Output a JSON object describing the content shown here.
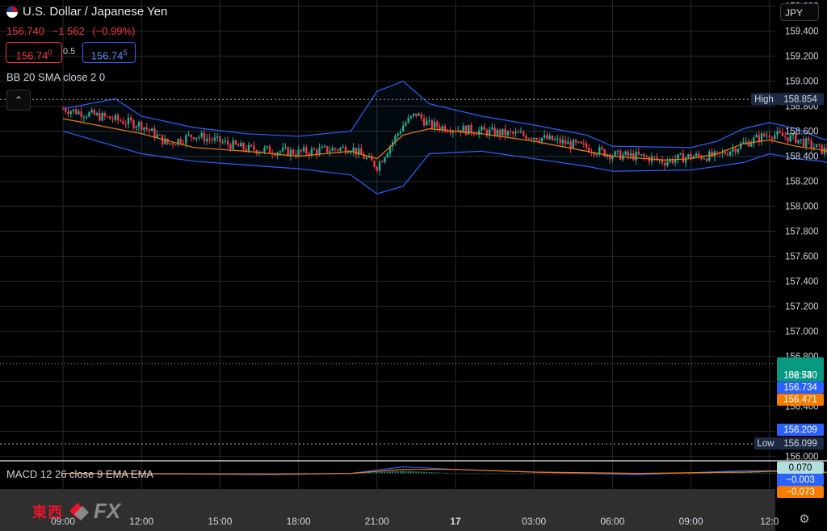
{
  "header": {
    "title": "U.S. Dollar / Japanese Yen",
    "last": "156.740",
    "change": "−1.562",
    "change_pct": "(−0.99%)",
    "bid_main": "156.74",
    "bid_sup": "0",
    "spread": "0.5",
    "ask_main": "156.74",
    "ask_sup": "5",
    "indicator": "BB 20 SMA close 2 0",
    "collapse_icon": "chevron-up-icon",
    "currency": "JPY"
  },
  "macd": {
    "label": "MACD 12 26 close 9 EMA EMA",
    "histogram_value": "0.070",
    "macd_value": "−0.003",
    "signal_value": "−0.073"
  },
  "badges": {
    "high_label": "High",
    "high_value": "158.854",
    "last_value": "156.740",
    "countdown": "02:53",
    "upper_band_value": "156.734",
    "basis_value": "156.471",
    "lower_band_value": "156.209",
    "low_label": "Low",
    "low_value": "156.099"
  },
  "watermark": {
    "kanji": "東西",
    "fx": "FX"
  },
  "colors": {
    "up": "#22ab94",
    "down": "#f23645",
    "band": "#2962ff",
    "basis": "#f57c00",
    "grid": "#2a2a2a",
    "macd_line": "#2962ff",
    "signal_line": "#f57c00"
  },
  "chart_data": {
    "type": "line",
    "y_ticks": [
      "159.600",
      "159.400",
      "159.200",
      "159.000",
      "158.800",
      "158.600",
      "158.400",
      "158.200",
      "158.000",
      "157.800",
      "157.600",
      "157.400",
      "157.200",
      "157.000",
      "156.800",
      "156.600",
      "156.400",
      "156.200",
      "156.000"
    ],
    "x_ticks": [
      "09:00",
      "12:00",
      "15:00",
      "18:00",
      "21:00",
      "17",
      "03:00",
      "06:00",
      "09:00",
      "12:0"
    ],
    "ylim": [
      155.97,
      159.65
    ],
    "series": [
      {
        "name": "BB 20 SMA close 2 0",
        "role": "close",
        "points": [
          [
            0,
            158.78
          ],
          [
            3,
            158.65
          ],
          [
            4,
            158.5
          ],
          [
            5,
            158.57
          ],
          [
            7,
            158.46
          ],
          [
            9,
            158.43
          ],
          [
            11,
            158.47
          ],
          [
            12,
            158.32
          ],
          [
            13,
            158.65
          ],
          [
            13.5,
            158.74
          ],
          [
            14,
            158.65
          ],
          [
            15,
            158.62
          ],
          [
            16,
            158.6
          ],
          [
            18,
            158.56
          ],
          [
            20,
            158.47
          ],
          [
            21,
            158.41
          ],
          [
            22,
            158.4
          ],
          [
            23,
            158.36
          ],
          [
            24,
            158.4
          ],
          [
            25,
            158.4
          ],
          [
            26,
            158.5
          ],
          [
            27,
            158.58
          ],
          [
            28,
            158.54
          ],
          [
            29,
            158.45
          ],
          [
            30,
            158.42
          ],
          [
            31,
            158.4
          ],
          [
            31.5,
            158.3
          ],
          [
            32,
            158.18
          ],
          [
            32.5,
            158.0
          ],
          [
            33,
            157.86
          ],
          [
            33.5,
            157.72
          ],
          [
            34,
            157.5
          ],
          [
            34.5,
            157.12
          ],
          [
            35,
            156.9
          ],
          [
            35.5,
            156.7
          ],
          [
            36,
            156.48
          ],
          [
            36.5,
            156.38
          ],
          [
            37,
            156.4
          ],
          [
            37.5,
            156.48
          ],
          [
            38,
            156.64
          ],
          [
            38.3,
            156.74
          ]
        ]
      },
      {
        "name": "upper band",
        "points": [
          [
            0,
            158.78
          ],
          [
            2,
            158.86
          ],
          [
            3,
            158.72
          ],
          [
            5,
            158.63
          ],
          [
            7,
            158.58
          ],
          [
            9,
            158.56
          ],
          [
            11,
            158.6
          ],
          [
            12,
            158.92
          ],
          [
            13,
            159.0
          ],
          [
            14,
            158.82
          ],
          [
            16,
            158.72
          ],
          [
            18,
            158.65
          ],
          [
            20,
            158.57
          ],
          [
            21,
            158.48
          ],
          [
            24,
            158.47
          ],
          [
            25,
            158.52
          ],
          [
            26,
            158.62
          ],
          [
            27,
            158.67
          ],
          [
            28,
            158.62
          ],
          [
            29,
            158.54
          ],
          [
            30,
            158.5
          ],
          [
            31,
            158.44
          ],
          [
            32,
            158.42
          ],
          [
            33,
            158.2
          ],
          [
            34,
            158.16
          ],
          [
            34.5,
            158.28
          ],
          [
            35,
            158.06
          ],
          [
            35.5,
            157.6
          ],
          [
            36,
            157.1
          ],
          [
            36.5,
            156.92
          ],
          [
            37,
            156.72
          ],
          [
            37.5,
            156.72
          ],
          [
            38,
            156.74
          ],
          [
            38.3,
            156.75
          ]
        ]
      },
      {
        "name": "basis",
        "points": [
          [
            0,
            158.7
          ],
          [
            3,
            158.58
          ],
          [
            5,
            158.47
          ],
          [
            7,
            158.44
          ],
          [
            9,
            158.4
          ],
          [
            11,
            158.44
          ],
          [
            12,
            158.38
          ],
          [
            13,
            158.57
          ],
          [
            14,
            158.62
          ],
          [
            16,
            158.58
          ],
          [
            18,
            158.52
          ],
          [
            20,
            158.44
          ],
          [
            21,
            158.4
          ],
          [
            23,
            158.37
          ],
          [
            24,
            158.38
          ],
          [
            25,
            158.42
          ],
          [
            26,
            158.5
          ],
          [
            27,
            158.53
          ],
          [
            28,
            158.48
          ],
          [
            29,
            158.45
          ],
          [
            30,
            158.4
          ],
          [
            31,
            158.3
          ],
          [
            32,
            158.1
          ],
          [
            33,
            157.85
          ],
          [
            34,
            157.48
          ],
          [
            35,
            157.08
          ],
          [
            35.5,
            156.76
          ],
          [
            36,
            156.55
          ],
          [
            36.5,
            156.4
          ],
          [
            37,
            156.34
          ],
          [
            37.5,
            156.38
          ],
          [
            38,
            156.42
          ],
          [
            38.3,
            156.47
          ]
        ]
      },
      {
        "name": "lower band",
        "points": [
          [
            0,
            158.6
          ],
          [
            3,
            158.42
          ],
          [
            5,
            158.36
          ],
          [
            7,
            158.33
          ],
          [
            9,
            158.3
          ],
          [
            11,
            158.25
          ],
          [
            12,
            158.1
          ],
          [
            13,
            158.16
          ],
          [
            14,
            158.42
          ],
          [
            16,
            158.44
          ],
          [
            18,
            158.38
          ],
          [
            20,
            158.32
          ],
          [
            21,
            158.28
          ],
          [
            24,
            158.29
          ],
          [
            25,
            158.32
          ],
          [
            26,
            158.35
          ],
          [
            27,
            158.42
          ],
          [
            28,
            158.38
          ],
          [
            29,
            158.36
          ],
          [
            30,
            158.3
          ],
          [
            31,
            158.18
          ],
          [
            32,
            157.8
          ],
          [
            33,
            157.48
          ],
          [
            34,
            157.02
          ],
          [
            35,
            156.6
          ],
          [
            35.5,
            156.28
          ],
          [
            36,
            156.08
          ],
          [
            36.5,
            156.06
          ],
          [
            37,
            156.14
          ],
          [
            37.5,
            156.2
          ],
          [
            38,
            156.22
          ],
          [
            38.3,
            156.21
          ]
        ]
      }
    ],
    "macd": {
      "ylim": [
        -0.12,
        0.09
      ],
      "macd_line": [
        [
          0,
          0.0
        ],
        [
          8,
          -0.01
        ],
        [
          11,
          0.0
        ],
        [
          13,
          0.05
        ],
        [
          15,
          0.03
        ],
        [
          18,
          0.01
        ],
        [
          22,
          -0.01
        ],
        [
          26,
          0.02
        ],
        [
          28,
          0.02
        ],
        [
          30,
          0.0
        ],
        [
          32,
          -0.04
        ],
        [
          34,
          -0.06
        ],
        [
          36,
          -0.1
        ],
        [
          37,
          -0.09
        ],
        [
          38,
          -0.02
        ],
        [
          38.3,
          -0.003
        ]
      ],
      "signal_line": [
        [
          0,
          0.0
        ],
        [
          8,
          -0.005
        ],
        [
          11,
          0.0
        ],
        [
          13,
          0.03
        ],
        [
          15,
          0.03
        ],
        [
          18,
          0.01
        ],
        [
          22,
          0.0
        ],
        [
          26,
          0.01
        ],
        [
          28,
          0.02
        ],
        [
          30,
          0.0
        ],
        [
          32,
          -0.02
        ],
        [
          34,
          -0.04
        ],
        [
          36,
          -0.09
        ],
        [
          37,
          -0.1
        ],
        [
          38,
          -0.08
        ],
        [
          38.3,
          -0.073
        ]
      ]
    }
  }
}
